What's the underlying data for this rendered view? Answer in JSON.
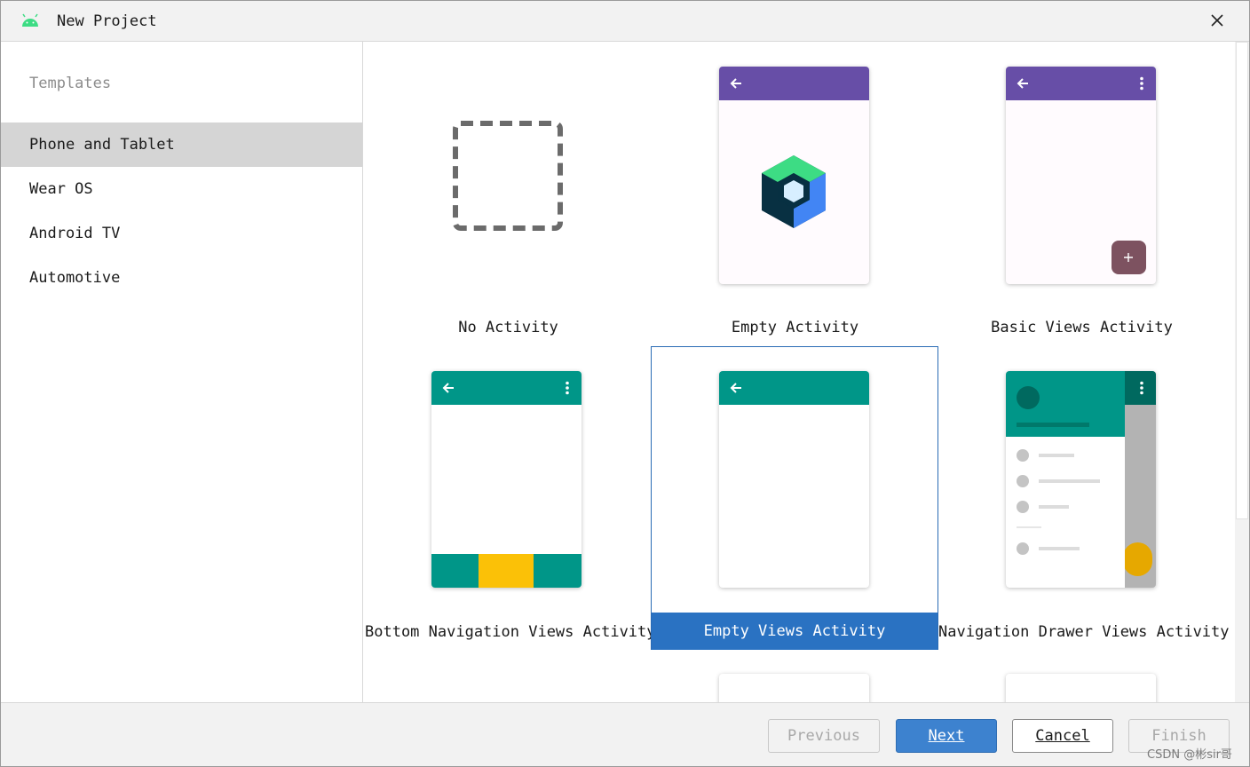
{
  "window": {
    "title": "New Project",
    "app_icon": "android-icon",
    "close_icon": "close-icon"
  },
  "sidebar": {
    "header": "Templates",
    "items": [
      {
        "label": "Phone and Tablet",
        "selected": true
      },
      {
        "label": "Wear OS",
        "selected": false
      },
      {
        "label": "Android TV",
        "selected": false
      },
      {
        "label": "Automotive",
        "selected": false
      }
    ]
  },
  "templates": [
    {
      "label": "No Activity",
      "selected": false
    },
    {
      "label": "Empty Activity",
      "selected": false
    },
    {
      "label": "Basic Views Activity",
      "selected": false
    },
    {
      "label": "Bottom Navigation Views Activity",
      "selected": false
    },
    {
      "label": "Empty Views Activity",
      "selected": true
    },
    {
      "label": "Navigation Drawer Views Activity",
      "selected": false
    }
  ],
  "footer": {
    "previous": "Previous",
    "next": "Next",
    "cancel": "Cancel",
    "finish": "Finish"
  },
  "watermark": "CSDN @彬sir哥",
  "colors": {
    "purple_bar": "#674ea7",
    "teal_bar": "#009688",
    "fab": "#7d5260",
    "selection": "#2a72c2",
    "yellow_tab": "#fbc107",
    "nav_fab": "#e6a800"
  }
}
